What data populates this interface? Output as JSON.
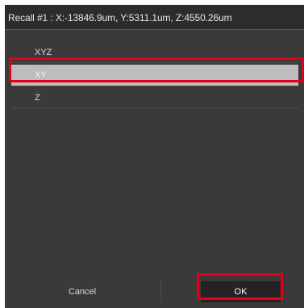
{
  "dialog": {
    "title": "Recall #1 : X:-13846.9um, Y:5311.1um, Z:4550.26um"
  },
  "list": {
    "items": [
      {
        "label": "XYZ",
        "selected": false
      },
      {
        "label": "XY",
        "selected": true
      },
      {
        "label": "Z",
        "selected": false
      }
    ]
  },
  "footer": {
    "cancel_label": "Cancel",
    "ok_label": "OK"
  },
  "annotations": {
    "highlight_color": "#e3001b"
  }
}
